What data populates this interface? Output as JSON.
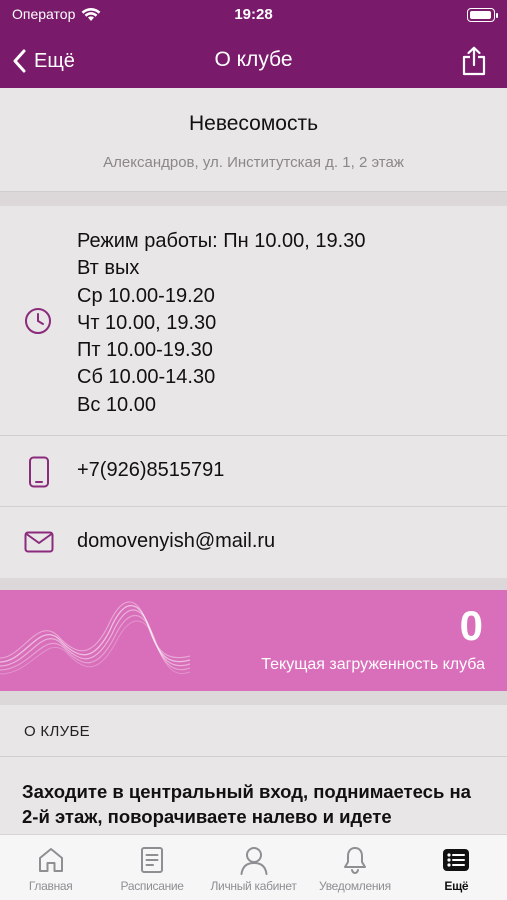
{
  "status_bar": {
    "carrier": "Оператор",
    "time": "19:28"
  },
  "nav": {
    "back_label": "Ещё",
    "title": "О клубе"
  },
  "club": {
    "name": "Невесомость",
    "address": "Александров, ул. Институтская д. 1, 2 этаж"
  },
  "info": {
    "hours_lines": [
      "Режим работы: Пн 10.00, 19.30",
      "Вт вых",
      "Ср 10.00-19.20",
      "Чт 10.00, 19.30",
      "Пт 10.00-19.30",
      "Сб 10.00-14.30",
      "Вс 10.00"
    ],
    "phone": "+7(926)8515791",
    "email": "domovenyish@mail.ru"
  },
  "load": {
    "value": "0",
    "label": "Текущая загруженность клуба"
  },
  "section": {
    "about_title": "О КЛУБЕ"
  },
  "description": {
    "text": "Заходите в центральный вход, поднимаетесь на 2-й этаж, поворачиваете налево и идете"
  },
  "tabbar": {
    "items": [
      {
        "label": "Главная",
        "icon": "home-icon"
      },
      {
        "label": "Расписание",
        "icon": "schedule-icon"
      },
      {
        "label": "Личный кабинет",
        "icon": "profile-icon"
      },
      {
        "label": "Уведомления",
        "icon": "bell-icon"
      },
      {
        "label": "Ещё",
        "icon": "more-list-icon"
      }
    ],
    "active_index": 4
  },
  "colors": {
    "brand": "#7a1a6b",
    "accent_icon": "#8a2b7c",
    "banner": "#d96fba",
    "background": "#e9e6e7"
  }
}
